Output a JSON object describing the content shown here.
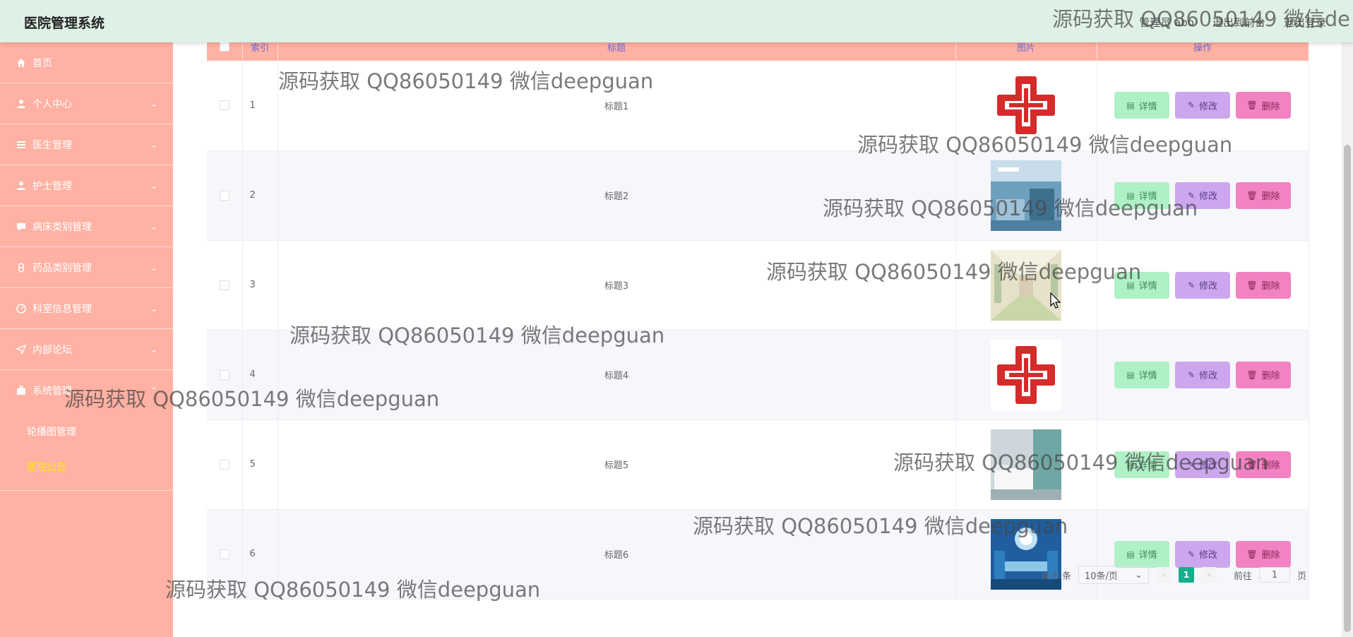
{
  "header": {
    "title": "医院管理系统",
    "user_label": "管理员 abo",
    "back_front_label": "退出到前台",
    "logout_label": "退出登录"
  },
  "sidebar": {
    "items": [
      {
        "label": "首页",
        "icon": "home-icon"
      },
      {
        "label": "个人中心",
        "icon": "user-icon"
      },
      {
        "label": "医生管理",
        "icon": "list-icon"
      },
      {
        "label": "护士管理",
        "icon": "user-icon"
      },
      {
        "label": "病床类别管理",
        "icon": "chat-icon"
      },
      {
        "label": "药品类别管理",
        "icon": "medicine-icon"
      },
      {
        "label": "科室信息管理",
        "icon": "dashboard-icon"
      },
      {
        "label": "内部论坛",
        "icon": "send-icon"
      },
      {
        "label": "系统管理",
        "icon": "briefcase-icon"
      }
    ],
    "submenu": [
      {
        "label": "轮播图管理"
      },
      {
        "label": "医院公告"
      }
    ]
  },
  "table": {
    "headers": [
      "",
      "索引",
      "标题",
      "图片",
      "操作"
    ],
    "rows": [
      {
        "index": "1",
        "title": "标题1",
        "image": "red-cross"
      },
      {
        "index": "2",
        "title": "标题2",
        "image": "ward-photo"
      },
      {
        "index": "3",
        "title": "标题3",
        "image": "corridor-photo"
      },
      {
        "index": "4",
        "title": "标题4",
        "image": "red-cross"
      },
      {
        "index": "5",
        "title": "标题5",
        "image": "room-photo"
      },
      {
        "index": "6",
        "title": "标题6",
        "image": "surgery-photo"
      }
    ],
    "actions": {
      "detail": "详情",
      "edit": "修改",
      "delete": "删除"
    }
  },
  "pagination": {
    "total": "共 6 条",
    "page_size": "10条/页",
    "current_page": "1",
    "goto_label": "前往",
    "goto_value": "1",
    "page_suffix": "页"
  },
  "watermark": {
    "text": "源码获取 QQ86050149 微信deepguan",
    "header_text": "源码获取 QQ86050149 微信de"
  },
  "colors": {
    "header_bg": "#dff1e6",
    "sidebar_bg": "#ffb1a3",
    "table_header_bg": "#ffb1a3",
    "detail_btn": "#b0f0c6",
    "edit_btn": "#cda7ee",
    "delete_btn": "#f183c2",
    "page_active": "#13b08d",
    "submenu_active": "#ffee00"
  }
}
